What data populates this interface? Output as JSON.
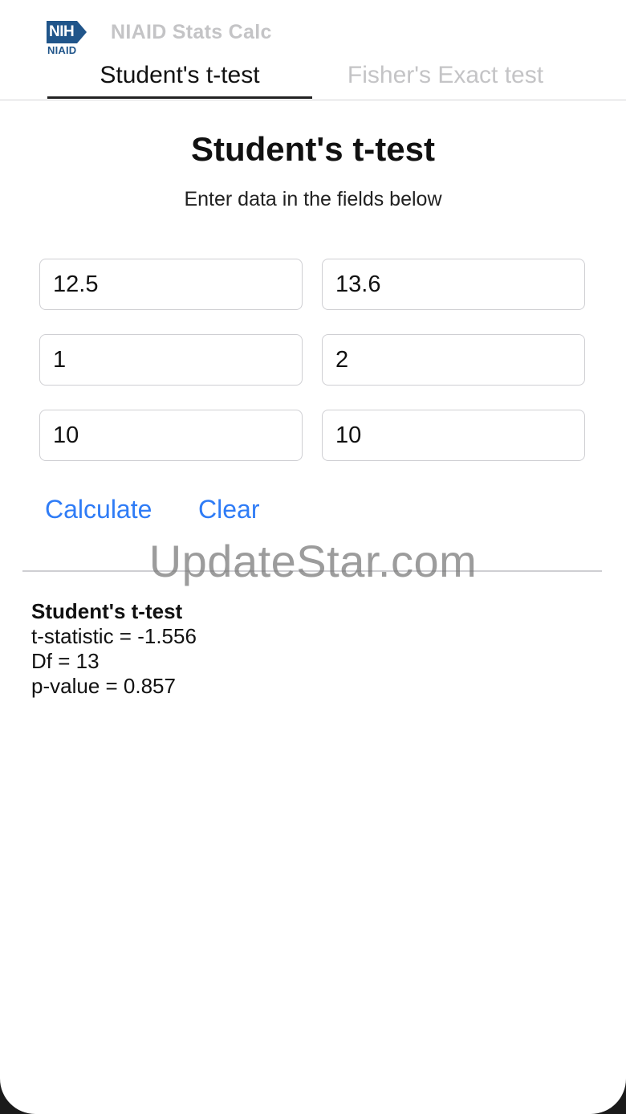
{
  "header": {
    "logo_text": "NIH",
    "logo_sub": "NIAID",
    "app_title": "NIAID Stats Calc"
  },
  "tabs": [
    {
      "label": "Student's t-test",
      "active": true
    },
    {
      "label": "Fisher's Exact test",
      "active": false
    }
  ],
  "main": {
    "title": "Student's t-test",
    "subtitle": "Enter data in the fields below",
    "fields": [
      {
        "value": "12.5"
      },
      {
        "value": "13.6"
      },
      {
        "value": "1"
      },
      {
        "value": "2"
      },
      {
        "value": "10"
      },
      {
        "value": "10"
      }
    ],
    "calculate_label": "Calculate",
    "clear_label": "Clear"
  },
  "watermark": "UpdateStar.com",
  "results": {
    "title": "Student's t-test",
    "t_statistic": "t-statistic = -1.556",
    "df": "Df = 13",
    "p_value": "p-value = 0.857"
  },
  "colors": {
    "accent": "#2f7cf6",
    "brand": "#20558a",
    "inactive": "#c4c4c6"
  }
}
